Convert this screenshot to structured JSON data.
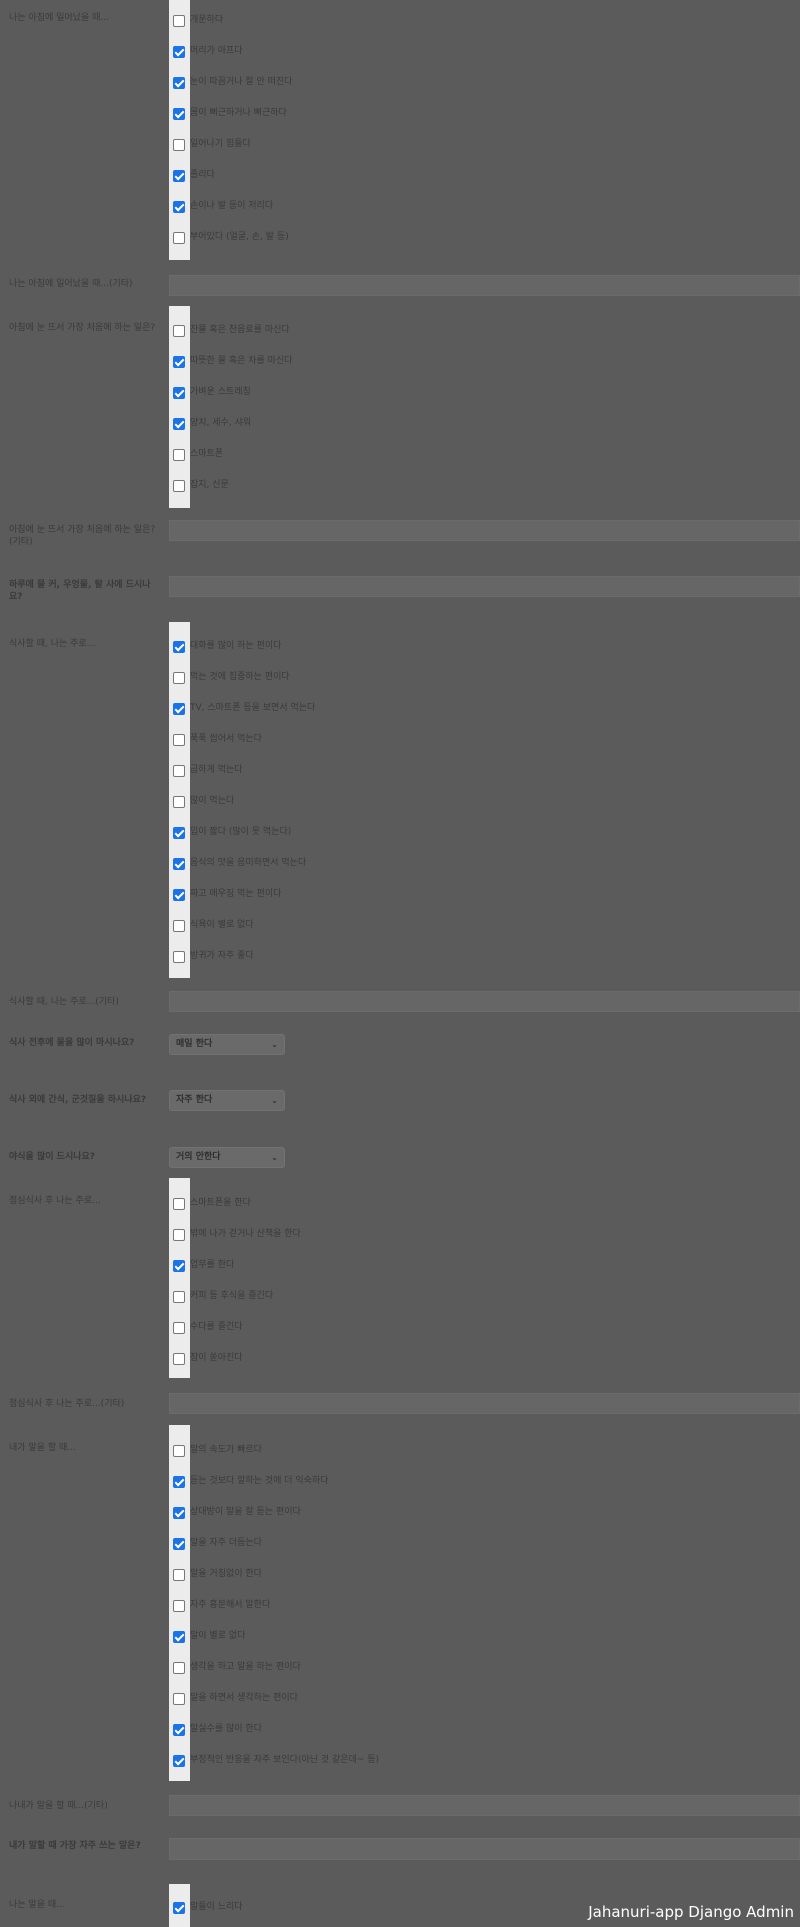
{
  "sections": {
    "wake1": {
      "label": "나는 아침에 일어났을 때...",
      "options": [
        {
          "label": "개운하다",
          "checked": false
        },
        {
          "label": "머리가 아프다",
          "checked": true
        },
        {
          "label": "눈이 따끔거나 잘 안 떠진다",
          "checked": true
        },
        {
          "label": "몸이 뻐근하거나 뻐근하다",
          "checked": true
        },
        {
          "label": "일어나기 힘들다",
          "checked": false
        },
        {
          "label": "졸리다",
          "checked": true
        },
        {
          "label": "손이나 발 등이 저리다",
          "checked": true
        },
        {
          "label": "부어있다 (얼굴, 손, 발 등)",
          "checked": false
        }
      ]
    },
    "wake1_other": {
      "label": "나는 아침에 일어났을 때...(기타)"
    },
    "morning_first": {
      "label": "아침에 눈 뜨서 가장 처음에 하는 일은?",
      "options": [
        {
          "label": "찬물 혹은 찬음료를 마신다",
          "checked": false
        },
        {
          "label": "따뜻한 물 혹은 차를 마신다",
          "checked": true
        },
        {
          "label": "가벼운 스트레칭",
          "checked": true
        },
        {
          "label": "양치, 세수, 샤워",
          "checked": true
        },
        {
          "label": "스마트폰",
          "checked": false
        },
        {
          "label": "잡지, 신문",
          "checked": false
        }
      ]
    },
    "morning_first_other": {
      "label": "아침에 눈 뜨서 가장 처음에 하는 일은?(기타)"
    },
    "water_habit": {
      "label": "하루에 물 커, 우엉물, 탈 사에 드시나요?"
    },
    "meal": {
      "label": "식사할 때, 나는 주로...",
      "options": [
        {
          "label": "대화를 많이 하는 편이다",
          "checked": true
        },
        {
          "label": "먹는 것에 집중하는 편이다",
          "checked": false
        },
        {
          "label": "TV, 스마트폰 등을 보면서 먹는다",
          "checked": true
        },
        {
          "label": "푹푹 씹어서 먹는다",
          "checked": false
        },
        {
          "label": "급하게 먹는다",
          "checked": false
        },
        {
          "label": "많이 먹는다",
          "checked": false
        },
        {
          "label": "입이 짧다 (많이 못 먹는다)",
          "checked": true
        },
        {
          "label": "음식의 맛을 음미하면서 먹는다",
          "checked": true
        },
        {
          "label": "짜고 매우징 먹는 편이다",
          "checked": true
        },
        {
          "label": "식욕이 별로 없다",
          "checked": false
        },
        {
          "label": "방귀가 자주 좋다",
          "checked": false
        }
      ]
    },
    "meal_other": {
      "label": "식사할 때, 나는 주로...(기타)"
    },
    "q_water": {
      "label": "식사 전후에 물을 많이 마시나요?",
      "value": "매일 한다"
    },
    "q_snack": {
      "label": "식사 외에 간식, 군것질을 하시나요?",
      "value": "자주 한다"
    },
    "q_alcohol": {
      "label": "야식을 많이 드시나요?",
      "value": "거의 안한다"
    },
    "after_lunch": {
      "label": "점심식사 후 나는 주로...",
      "options": [
        {
          "label": "스마트폰을 한다",
          "checked": false
        },
        {
          "label": "밖에 나가 걷거나 산책을 한다",
          "checked": false
        },
        {
          "label": "업무를 한다",
          "checked": true
        },
        {
          "label": "커피 등 후식을 즐긴다",
          "checked": false
        },
        {
          "label": "수다를 즐긴다",
          "checked": false
        },
        {
          "label": "잠이 쏟아진다",
          "checked": false
        }
      ]
    },
    "after_lunch_other": {
      "label": "점심식사 후 나는 주로...(기타)"
    },
    "speaking": {
      "label": "내가 말을 할 때...",
      "options": [
        {
          "label": "말의 속도가 빠르다",
          "checked": false
        },
        {
          "label": "듣는 것보다 말하는 것에 더 익숙하다",
          "checked": true
        },
        {
          "label": "상대방이 말을 잘 듣는 편이다",
          "checked": true
        },
        {
          "label": "말을 자주 더듬는다",
          "checked": true
        },
        {
          "label": "말을 거침없이 한다",
          "checked": false
        },
        {
          "label": "자주 흥분해서 말한다",
          "checked": false
        },
        {
          "label": "말이 별로 없다",
          "checked": true
        },
        {
          "label": "생각을 하고 말을 하는 편이다",
          "checked": false
        },
        {
          "label": "말을 하면서 생각하는 편이다",
          "checked": false
        },
        {
          "label": "말실수를 많이 한다",
          "checked": true
        },
        {
          "label": "부정적인 반응을 자주 보인다(아닌 것 같은데~ 등)",
          "checked": true
        }
      ]
    },
    "speaking_other": {
      "label": "나내가 말을 할 때...(기타)"
    },
    "speaking_often": {
      "label": "내가 말할 때 가장 자주 쓰는 말은?"
    },
    "listening": {
      "label": "나는 말을 때...",
      "options": [
        {
          "label": "말들이 느리다",
          "checked": true
        }
      ]
    }
  },
  "brand": "Jahanuri-app Django Admin"
}
